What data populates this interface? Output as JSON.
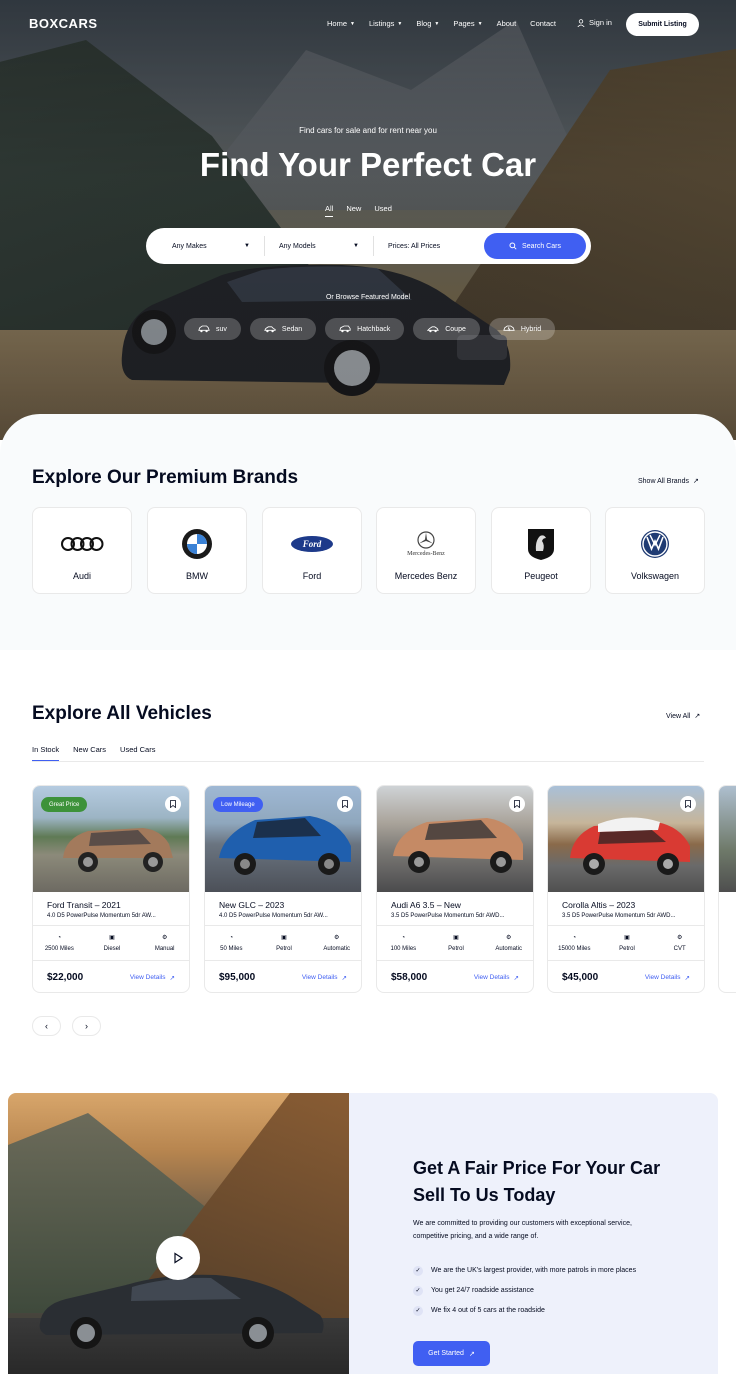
{
  "nav": {
    "logo": "BOXCARS",
    "items": [
      "Home",
      "Listings",
      "Blog",
      "Pages",
      "About",
      "Contact"
    ],
    "signin": "Sign in",
    "submit": "Submit Listing"
  },
  "hero": {
    "subtitle": "Find cars for sale and for rent near you",
    "title": "Find Your Perfect Car",
    "tabs": [
      "All",
      "New",
      "Used"
    ],
    "search": {
      "makes": "Any Makes",
      "models": "Any Models",
      "prices": "Prices: All Prices",
      "button": "Search Cars"
    },
    "browse": "Or Browse Featured Model",
    "chips": [
      {
        "label": "suv",
        "icon": "suv-icon"
      },
      {
        "label": "Sedan",
        "icon": "sedan-icon"
      },
      {
        "label": "Hatchback",
        "icon": "hatchback-icon"
      },
      {
        "label": "Coupe",
        "icon": "coupe-icon"
      },
      {
        "label": "Hybrid",
        "icon": "hybrid-icon"
      }
    ]
  },
  "brands": {
    "title": "Explore Our Premium Brands",
    "link": "Show All Brands",
    "items": [
      "Audi",
      "BMW",
      "Ford",
      "Mercedes Benz",
      "Peugeot",
      "Volkswagen"
    ],
    "mercedes_word": "Mercedes-Benz",
    "ford_word": "Ford"
  },
  "vehicles": {
    "title": "Explore All Vehicles",
    "link": "View All",
    "tabs": [
      "In Stock",
      "New Cars",
      "Used Cars"
    ],
    "cards": [
      {
        "badge": "Great Price",
        "badge_color": "#3d923a",
        "title": "Ford Transit – 2021",
        "desc": "4.0 D5 PowerPulse Momentum 5dr AW...",
        "miles": "2500 Miles",
        "fuel": "Diesel",
        "trans": "Manual",
        "price": "$22,000",
        "details": "View Details"
      },
      {
        "badge": "Low Mileage",
        "badge_color": "#405ff2",
        "title": "New GLC – 2023",
        "desc": "4.0 D5 PowerPulse Momentum 5dr AW...",
        "miles": "50 Miles",
        "fuel": "Petrol",
        "trans": "Automatic",
        "price": "$95,000",
        "details": "View Details"
      },
      {
        "badge": "",
        "badge_color": "",
        "title": "Audi A6 3.5 – New",
        "desc": "3.5 D5 PowerPulse Momentum 5dr AWD...",
        "miles": "100 Miles",
        "fuel": "Petrol",
        "trans": "Automatic",
        "price": "$58,000",
        "details": "View Details"
      },
      {
        "badge": "",
        "badge_color": "",
        "title": "Corolla Altis – 2023",
        "desc": "3.5 D5 PowerPulse Momentum 5dr AWD...",
        "miles": "15000 Miles",
        "fuel": "Petrol",
        "trans": "CVT",
        "price": "$45,000",
        "details": "View Details"
      }
    ]
  },
  "sell": {
    "title": "Get A Fair Price For Your Car Sell To Us Today",
    "desc": "We are committed to providing our customers with exceptional service, competitive pricing, and a wide range of.",
    "items": [
      "We are the UK's largest provider, with more patrols in more places",
      "You get 24/7 roadside assistance",
      "We fix 4 out of 5 cars at the roadside"
    ],
    "button": "Get Started"
  }
}
